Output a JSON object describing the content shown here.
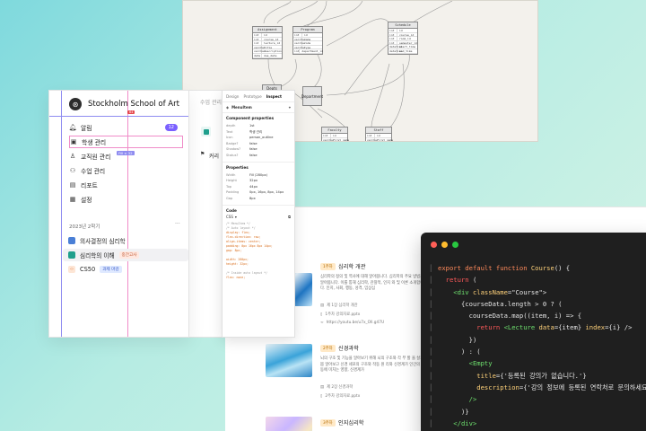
{
  "er": {
    "tables": [
      {
        "title": "Assignment",
        "rows": [
          [
            "int",
            "id"
          ],
          [
            "int",
            "course_id"
          ],
          [
            "int",
            "lecture_id"
          ],
          [
            "varchar",
            "title"
          ],
          [
            "varchar",
            "description"
          ],
          [
            "date",
            "due_date"
          ]
        ]
      },
      {
        "title": "Program",
        "rows": [
          [
            "int",
            "id"
          ],
          [
            "varchar",
            "name"
          ],
          [
            "varchar",
            "code"
          ],
          [
            "varchar",
            "type"
          ],
          [
            "int",
            "department_id"
          ]
        ]
      },
      {
        "title": "Schedule",
        "rows": [
          [
            "int",
            "id"
          ],
          [
            "int",
            "course_id"
          ],
          [
            "int",
            "room_id"
          ],
          [
            "int",
            "semester_id"
          ],
          [
            "datetime",
            "start_time"
          ],
          [
            "datetime",
            "end_time"
          ]
        ]
      },
      {
        "title": "Faculty",
        "rows": [
          [
            "int",
            "id"
          ],
          [
            "varchar",
            "first_name"
          ]
        ]
      },
      {
        "title": "Staff",
        "rows": [
          [
            "int",
            "id"
          ],
          [
            "varchar",
            "first_name"
          ]
        ]
      }
    ],
    "boxes": [
      "Depts",
      "Department"
    ]
  },
  "sidebar": {
    "logo": "⊛",
    "school_name": "Stockholm School of Art",
    "red_tag": "64",
    "purple_chip": "Fill × 32",
    "nav": [
      {
        "icon": "bell-icon",
        "label": "알림",
        "count": "12"
      },
      {
        "icon": "student-icon",
        "label": "학생 관리"
      },
      {
        "icon": "faculty-icon",
        "label": "교직원 관리"
      },
      {
        "icon": "class-icon",
        "label": "수업 관리"
      },
      {
        "icon": "report-icon",
        "label": "리포트"
      },
      {
        "icon": "settings-icon",
        "label": "설정"
      }
    ],
    "term_label": "2023년 2학기",
    "term_more": "···",
    "courses": [
      {
        "label": "의사결정의 심리학",
        "color": "#4a7fd6"
      },
      {
        "label": "심리학의 이해",
        "color": "#1f9f8c",
        "chip": "중간고사"
      },
      {
        "label": "CS50",
        "color": "#e07a3f",
        "chip": "과제 마감"
      }
    ]
  },
  "content": {
    "top_label": "수업 관리",
    "section_label": "커리"
  },
  "inspector": {
    "tabs": [
      "Design",
      "Prototype",
      "Inspect"
    ],
    "component": "MenuItem",
    "component_props_title": "Component properties",
    "component_props": [
      [
        "depth",
        "1st"
      ],
      [
        "Text",
        "학생 관리"
      ],
      [
        "Icon",
        "person_outline"
      ],
      [
        "Badge?",
        "false"
      ],
      [
        "Shadow?",
        "false"
      ],
      [
        "Status?",
        "false"
      ]
    ],
    "properties_title": "Properties",
    "properties": [
      [
        "Width",
        "Fill (280px)"
      ],
      [
        "Height",
        "32px"
      ],
      [
        "Top",
        "44px"
      ],
      [
        "Padding",
        "0px, 16px, 8px, 14px"
      ],
      [
        "Gap",
        "8px"
      ]
    ],
    "code_title": "Code",
    "code_lang": "CSS",
    "code": [
      {
        "t": "/* MenuItem */",
        "c": "gray"
      },
      {
        "t": "/* Auto layout */",
        "c": "gray"
      },
      {
        "t": "display: flex;",
        "c": "orange"
      },
      {
        "t": "flex-direction: row;",
        "c": "orange"
      },
      {
        "t": "align-items: center;",
        "c": "orange"
      },
      {
        "t": "padding: 0px 16px 8px 14px;",
        "c": "orange"
      },
      {
        "t": "gap: 8px;",
        "c": "orange"
      },
      {
        "t": "",
        "c": "gray"
      },
      {
        "t": "width: 280px;",
        "c": "orange"
      },
      {
        "t": "height: 32px;",
        "c": "orange"
      },
      {
        "t": "",
        "c": "gray"
      },
      {
        "t": "/* Inside auto layout */",
        "c": "gray"
      },
      {
        "t": "flex: none;",
        "c": "orange"
      }
    ]
  },
  "lessons": [
    {
      "week": "1주차",
      "title": "심리학 개관",
      "desc": "심리학의 정의 및 역사에 대해 알아봅니다. 심리학의 주요 방법을 알아봅니다. 이를 통해 심리학, 관찰적, 인지 와 및 이론 소개합니다. 인지, 사회, 행동, 성격, 임상심",
      "meta": [
        "제 1장 심리학 개관",
        "1주차 강의자료.pptx",
        "https://youtu.be/u7x_Oll.g47U"
      ]
    },
    {
      "week": "2주차",
      "title": "신경과학",
      "desc": "뇌의 구조 및 기능을 알아보기 위해 뇌의 구조와 각 부 할 을 살펴봅 알아보고 신경 세포의 구조와 작동 원 리와 신경계가 인간의 행동에 미치는 영향, 신경계가",
      "meta": [
        "제 2장 신경과학",
        "2주차 강의자료.pptx"
      ]
    },
    {
      "week": "3주차",
      "title": "인지심리학",
      "desc": "",
      "meta": []
    }
  ],
  "editor": {
    "dots": [
      "#ff5f57",
      "#febc2e",
      "#28c840"
    ],
    "lines": [
      [
        [
          "export default function ",
          "#ff8a5b"
        ],
        [
          "Course",
          "#ffd27a"
        ],
        [
          "() {",
          "#e6e6e6"
        ]
      ],
      [
        [
          "  return ",
          "#ff5a5a"
        ],
        [
          "(",
          "#e6e6e6"
        ]
      ],
      [
        [
          "    <div ",
          "#6ee06e"
        ],
        [
          "className",
          "#ffd27a"
        ],
        [
          "=\"Course\">",
          "#e6e6e6"
        ]
      ],
      [
        [
          "      {courseData.length > 0 ? (",
          "#e6e6e6"
        ]
      ],
      [
        [
          "        courseData.map((item, i) => {",
          "#e6e6e6"
        ]
      ],
      [
        [
          "          return ",
          "#ff5a5a"
        ],
        [
          "<Lecture ",
          "#6ee06e"
        ],
        [
          "data",
          "#ffd27a"
        ],
        [
          "={item} ",
          "#e6e6e6"
        ],
        [
          "index",
          "#ffd27a"
        ],
        [
          "={i} />",
          "#e6e6e6"
        ]
      ],
      [
        [
          "        })",
          "#e6e6e6"
        ]
      ],
      [
        [
          "      ) : (",
          "#e6e6e6"
        ]
      ],
      [
        [
          "        <Empty",
          "#6ee06e"
        ]
      ],
      [
        [
          "          title",
          "#ffd27a"
        ],
        [
          "={'등록된 강의가 없습니다.'}",
          "#e6e6e6"
        ]
      ],
      [
        [
          "          description",
          "#ffd27a"
        ],
        [
          "={'강의 정보에 등록된 연락처로 문의하세요.'}",
          "#e6e6e6"
        ]
      ],
      [
        [
          "        />",
          "#6ee06e"
        ]
      ],
      [
        [
          "      )}",
          "#e6e6e6"
        ]
      ],
      [
        [
          "    </div>",
          "#6ee06e"
        ]
      ],
      [
        [
          "  )",
          "#e6e6e6"
        ]
      ]
    ]
  }
}
